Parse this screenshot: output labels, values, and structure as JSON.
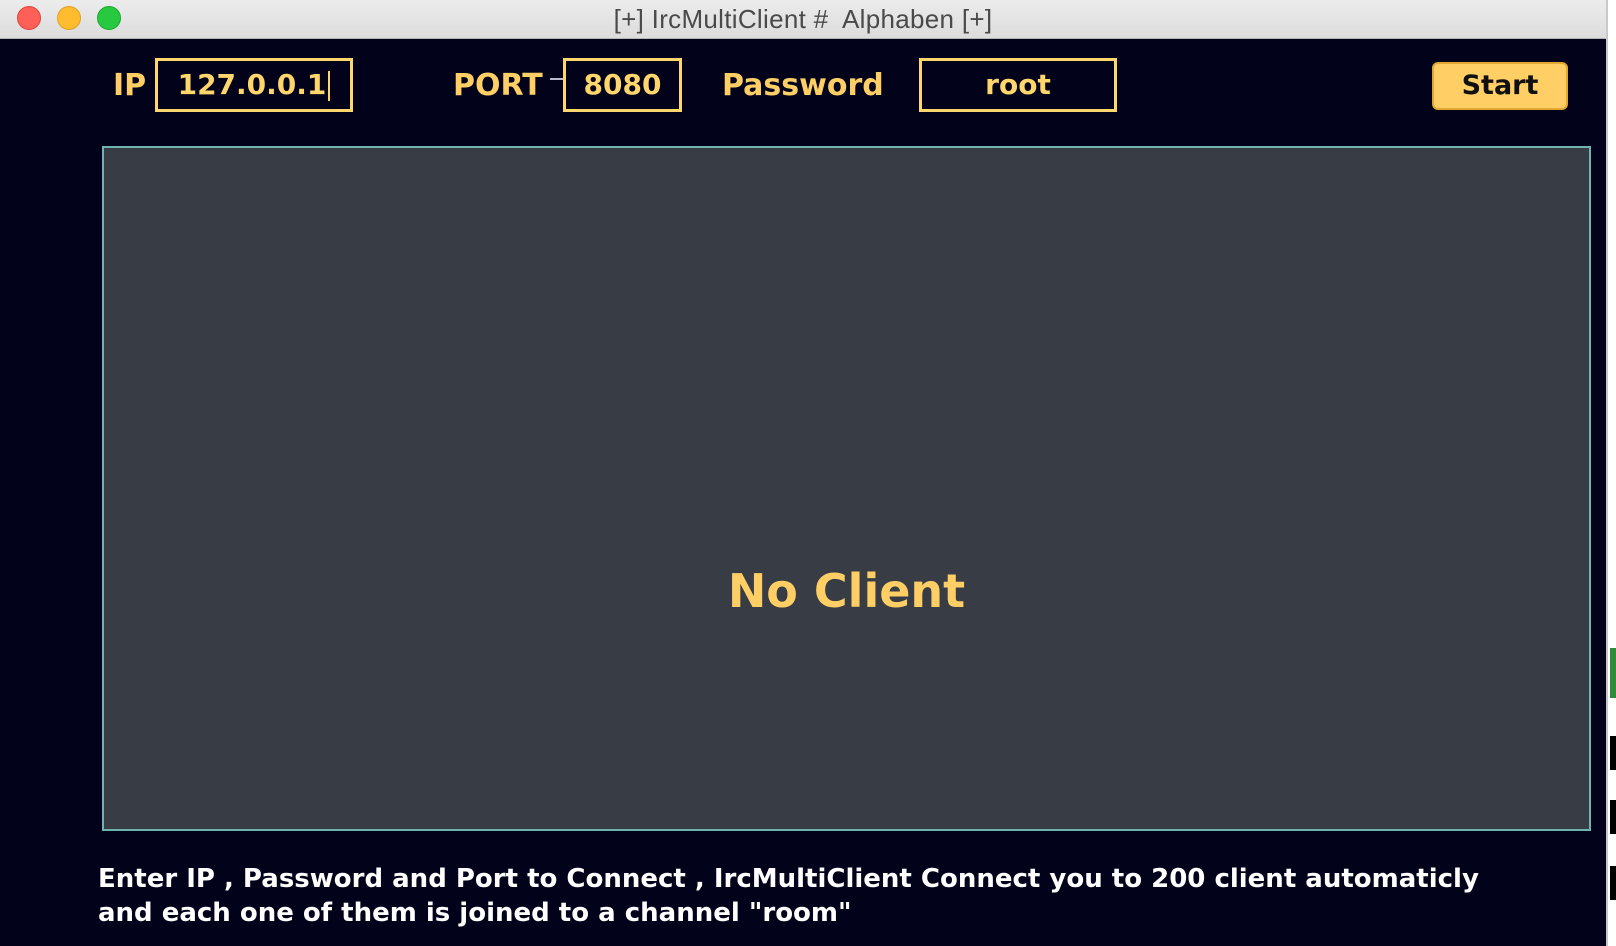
{
  "window": {
    "title": "[+] IrcMultiClient #  Alphaben [+]"
  },
  "form": {
    "ip_label": "IP",
    "ip_value": "127.0.0.1",
    "port_label": "PORT",
    "port_value": "8080",
    "password_label": "Password",
    "password_value": "root",
    "start_label": "Start"
  },
  "clients_panel": {
    "empty_message": "No Client"
  },
  "help": {
    "line1": "Enter IP , Password and Port to Connect , IrcMultiClient Connect you to 200 client automaticly",
    "line2": "and each one of them is joined to a channel \"room\""
  },
  "colors": {
    "background": "#02021a",
    "accent": "#ffcf66",
    "panel": "#383c44",
    "panel_border": "#6fb3b1"
  }
}
